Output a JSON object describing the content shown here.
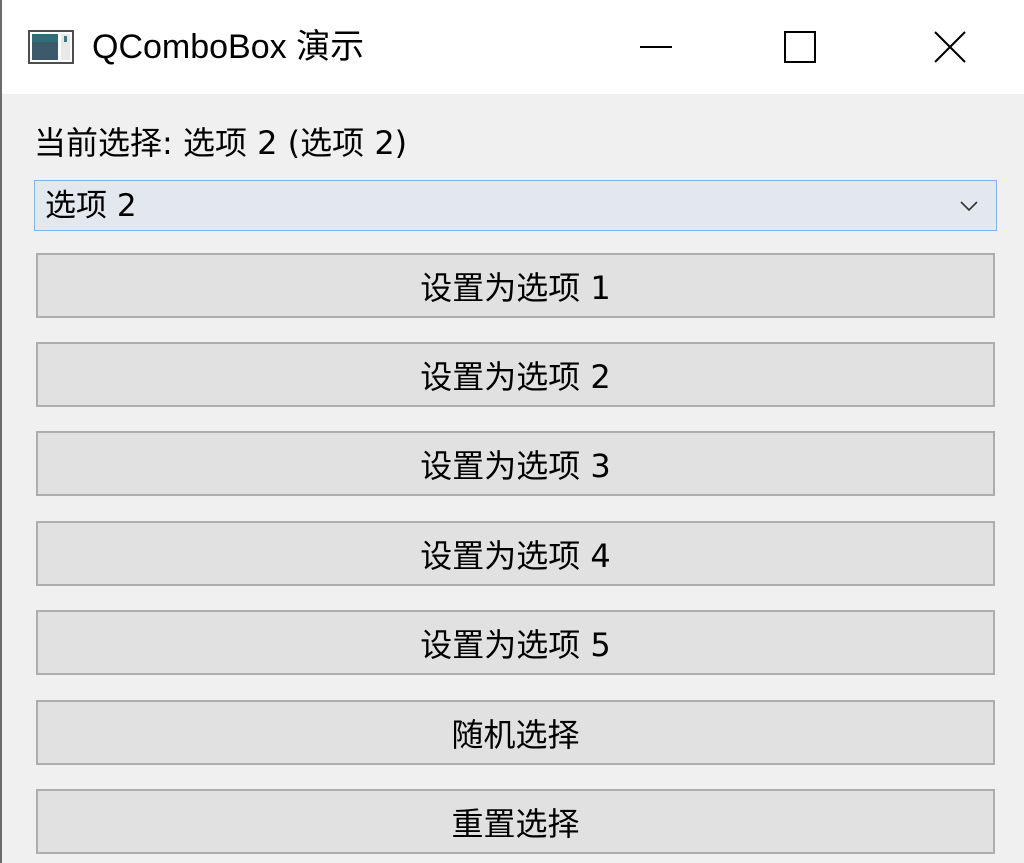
{
  "window": {
    "title": "QComboBox 演示",
    "app_icon": "window-app-icon",
    "controls": {
      "minimize_icon": "minimize-icon",
      "maximize_icon": "maximize-icon",
      "close_icon": "close-icon"
    }
  },
  "status": {
    "current_selection_text": "当前选择: 选项 2 (选项 2)"
  },
  "combo": {
    "selected_value": "选项 2",
    "arrow_icon": "chevron-down-icon"
  },
  "buttons": {
    "set_option_1": "设置为选项 1",
    "set_option_2": "设置为选项 2",
    "set_option_3": "设置为选项 3",
    "set_option_4": "设置为选项 4",
    "set_option_5": "设置为选项 5",
    "random_select": "随机选择",
    "reset_select": "重置选择"
  },
  "colors": {
    "window_bg": "#f0f0f0",
    "titlebar_bg": "#ffffff",
    "button_bg": "#e1e1e1",
    "button_border": "#adadad",
    "combo_border_focus": "#7eb4ea"
  }
}
